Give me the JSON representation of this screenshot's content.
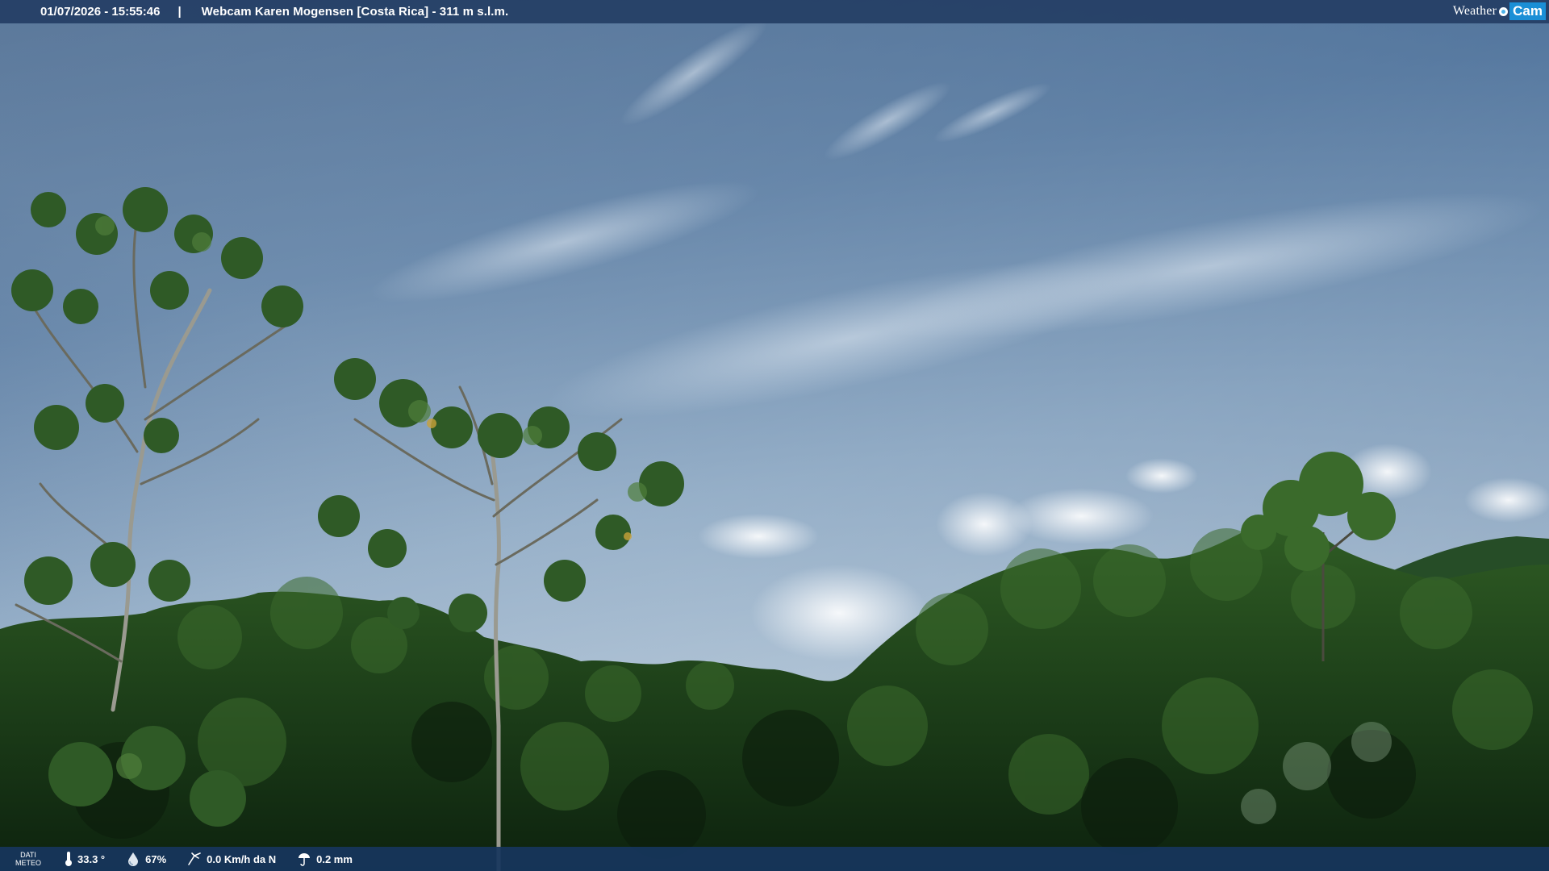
{
  "header": {
    "timestamp": "01/07/2026 - 15:55:46",
    "separator": "|",
    "title": "Webcam Karen Mogensen [Costa Rica] - 311 m s.l.m."
  },
  "logo": {
    "weather": "Weather",
    "cam": "Cam"
  },
  "footer": {
    "label_line1": "DATI",
    "label_line2": "METEO",
    "temperature": "33.3 °",
    "humidity": "67%",
    "wind": "0.0 Km/h da N",
    "rain": "0.2 mm"
  },
  "icons": {
    "thermometer": "thermometer-icon",
    "humidity": "humidity-icon",
    "wind": "wind-icon",
    "rain": "rain-icon"
  },
  "colors": {
    "topbar": "#253e65",
    "bottombar": "#17365c",
    "sky_top": "#2c4d78",
    "sky_bottom": "#c4d2df",
    "foliage_dark": "#0f2610",
    "foliage_light": "#3c6f2c",
    "logo_cam": "#1b8fd6"
  }
}
